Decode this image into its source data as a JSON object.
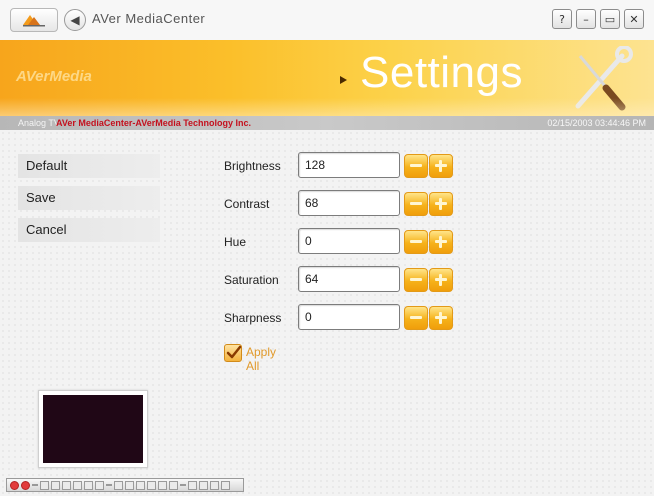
{
  "titlebar": {
    "app_title": "AVer MediaCenter",
    "logo_icon": "aver-logo-icon",
    "back_icon": "back-arrow-icon",
    "window_buttons": [
      {
        "name": "help-button",
        "glyph": "?"
      },
      {
        "name": "minimize-button",
        "glyph": "–"
      },
      {
        "name": "restore-button",
        "glyph": "▭"
      },
      {
        "name": "close-button",
        "glyph": "✕"
      }
    ]
  },
  "header": {
    "brand": "AVerMedia",
    "title": "Settings",
    "accent_color": "#f7a51c",
    "tools_icon": "wrench-screwdriver-icon"
  },
  "infostrip": {
    "source": "Analog TV",
    "company": "AVer MediaCenter-AVerMedia Technology Inc.",
    "datetime": "02/15/2003 03:44:46 PM"
  },
  "menu": {
    "items": [
      {
        "label": "Default"
      },
      {
        "label": "Save"
      },
      {
        "label": "Cancel"
      }
    ]
  },
  "settings": [
    {
      "label": "Brightness",
      "value": "128"
    },
    {
      "label": "Contrast",
      "value": "68"
    },
    {
      "label": "Hue",
      "value": "0"
    },
    {
      "label": "Saturation",
      "value": "64"
    },
    {
      "label": "Sharpness",
      "value": "0"
    }
  ],
  "apply_all": {
    "label": "Apply All",
    "checked": true
  },
  "preview": {
    "screen_color": "#200716"
  }
}
